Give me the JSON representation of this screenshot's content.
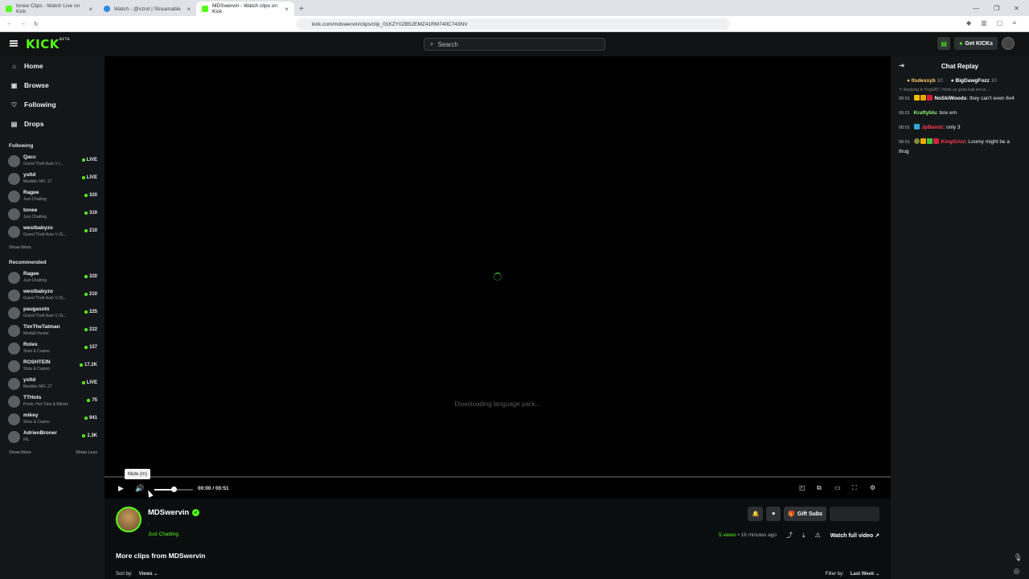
{
  "browser": {
    "tabs": [
      {
        "label": "tonee Clips - Watch Live on Kick",
        "active": false
      },
      {
        "label": "Watch - @xznd | Streamable",
        "active": false
      },
      {
        "label": "MDSwervin - Watch clips on Kick",
        "active": true
      }
    ],
    "new_tab": "+",
    "url": "kick.com/mdswervin/clips/clip_01KZY0ZB52EMZ41RM740C743NV"
  },
  "header": {
    "logo": "KICK",
    "logo_tag": "BETA",
    "search_placeholder": "Search",
    "get_kicks": "Get KICKs"
  },
  "sidebar": {
    "nav": [
      {
        "label": "Home",
        "icon": "home-icon"
      },
      {
        "label": "Browse",
        "icon": "browse-icon"
      },
      {
        "label": "Following",
        "icon": "heart-icon"
      },
      {
        "label": "Drops",
        "icon": "drops-icon"
      }
    ],
    "following_title": "Following",
    "following": [
      {
        "name": "Qacc",
        "game": "Grand Theft Auto V (...",
        "count": "LIVE"
      },
      {
        "name": "ysltd",
        "game": "Madden NFL 27",
        "count": "LIVE"
      },
      {
        "name": "Ragee",
        "game": "Just Chatting",
        "count": "320"
      },
      {
        "name": "tonee",
        "game": "Just Chatting",
        "count": "310"
      },
      {
        "name": "westbabyzo",
        "game": "Grand Theft Auto V (G...",
        "count": "210"
      }
    ],
    "show_more": "Show More",
    "recommended_title": "Recommended",
    "recommended": [
      {
        "name": "Ragee",
        "game": "Just Chatting",
        "count": "320"
      },
      {
        "name": "westbabyzo",
        "game": "Grand Theft Auto V (G...",
        "count": "210"
      },
      {
        "name": "paugasotx",
        "game": "Grand Theft Auto V (G...",
        "count": "225"
      },
      {
        "name": "TimTheTatman",
        "game": "Mistfall Hunter",
        "count": "222"
      },
      {
        "name": "Rolex",
        "game": "Slots & Casino",
        "count": "157"
      },
      {
        "name": "ROSHTEIN",
        "game": "Slots & Casino",
        "count": "17.2K"
      },
      {
        "name": "ysltd",
        "game": "Madden NFL 27",
        "count": "LIVE"
      },
      {
        "name": "TTHots",
        "game": "Pools, Hot Tubs & Bikinis",
        "count": "75"
      },
      {
        "name": "mikey",
        "game": "Slots & Casino",
        "count": "941"
      },
      {
        "name": "AdrienBroner",
        "game": "IRL",
        "count": "1.3K"
      }
    ],
    "show_more_2": "Show More",
    "show_less": "Show Less"
  },
  "player": {
    "status_text": "Downloading language pack...",
    "time": "00:00 / 00:51",
    "volume_fraction": 0.5,
    "tooltip": "Mute (m)"
  },
  "clip_info": {
    "streamer": "MDSwervin",
    "subtitle": ".",
    "category": "Just Chatting",
    "gift_subs": "Gift Subs",
    "views": "5 views",
    "ago": "• 16 minutes ago",
    "watch_full": "Watch full video",
    "more_clips": "More clips from MDSwervin",
    "sort_by_label": "Sort by:",
    "sort_by_value": "Views",
    "filter_by_label": "Filter by:",
    "filter_by_value": "Last Week"
  },
  "chat": {
    "title": "Chat Replay",
    "pinned": [
      {
        "name": "Itsdessyb",
        "count": "10"
      },
      {
        "name": "BigDawgFozz",
        "count": "10"
      }
    ],
    "reply_line": "Replying to YngSAT: I think ya gotta bait em to ...",
    "messages": [
      {
        "ts": "00:01",
        "user": "NoSkiWoods",
        "text": "they can't even 6v4",
        "color": "white"
      },
      {
        "ts": "00:01",
        "user": "Kraftyblu",
        "text": "box em",
        "color": "green"
      },
      {
        "ts": "00:01",
        "user": "JpBandz",
        "text": "only 3",
        "color": "red"
      },
      {
        "ts": "00:01",
        "user": "KingGrizz",
        "text": "Loomy might be a thug",
        "color": "red"
      }
    ]
  },
  "colors": {
    "accent": "#53fc18",
    "bg": "#0b0e0f",
    "panel": "#141719"
  }
}
